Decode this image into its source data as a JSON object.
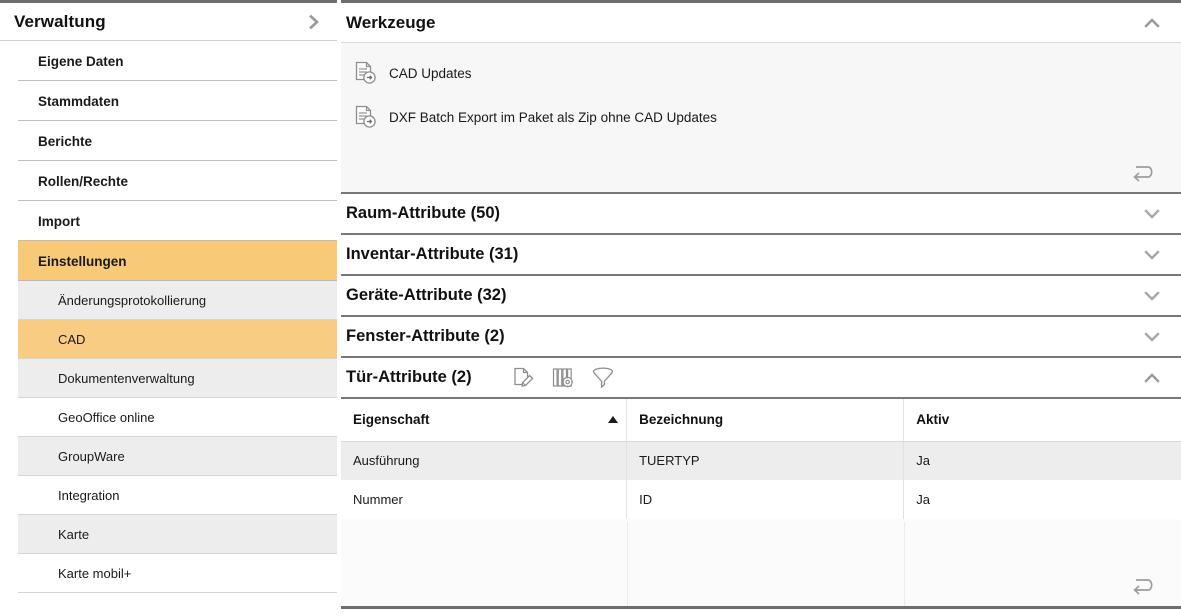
{
  "sidebar": {
    "title": "Verwaltung",
    "expand_icon": "chevron-right-icon",
    "items": [
      {
        "label": "Eigene Daten",
        "selected": false
      },
      {
        "label": "Stammdaten",
        "selected": false
      },
      {
        "label": "Berichte",
        "selected": false
      },
      {
        "label": "Rollen/Rechte",
        "selected": false
      },
      {
        "label": "Import",
        "selected": false
      },
      {
        "label": "Einstellungen",
        "selected": true
      }
    ],
    "subitems": [
      {
        "label": "Änderungsprotokollierung",
        "selected": false,
        "shaded": true
      },
      {
        "label": "CAD",
        "selected": true,
        "shaded": false
      },
      {
        "label": "Dokumentenverwaltung",
        "selected": false,
        "shaded": true
      },
      {
        "label": "GeoOffice online",
        "selected": false,
        "shaded": false
      },
      {
        "label": "GroupWare",
        "selected": false,
        "shaded": true
      },
      {
        "label": "Integration",
        "selected": false,
        "shaded": false
      },
      {
        "label": "Karte",
        "selected": false,
        "shaded": true
      },
      {
        "label": "Karte mobil+",
        "selected": false,
        "shaded": false
      }
    ],
    "highlight_color": "#f8c977",
    "subhighlight_color": "#f8cd83"
  },
  "tools_panel": {
    "title": "Werkzeuge",
    "collapse_icon": "chevron-up-icon",
    "expanded": true,
    "items": [
      {
        "label": "CAD Updates",
        "icon": "document-export-icon"
      },
      {
        "label": "DXF Batch Export im Paket als Zip ohne CAD Updates",
        "icon": "document-export-icon"
      }
    ],
    "undo_icon": "return-arrow-icon"
  },
  "sections": [
    {
      "title": "Raum-Attribute (50)",
      "count": 50,
      "expanded": false,
      "icon": "chevron-down-icon"
    },
    {
      "title": "Inventar-Attribute (31)",
      "count": 31,
      "expanded": false,
      "icon": "chevron-down-icon"
    },
    {
      "title": "Geräte-Attribute (32)",
      "count": 32,
      "expanded": false,
      "icon": "chevron-down-icon"
    },
    {
      "title": "Fenster-Attribute (2)",
      "count": 2,
      "expanded": false,
      "icon": "chevron-down-icon"
    }
  ],
  "open_section": {
    "title": "Tür-Attribute (2)",
    "count": 2,
    "expanded": true,
    "collapse_icon": "chevron-up-icon",
    "toolbar": [
      {
        "name": "edit-document-icon",
        "label": "Bearbeiten"
      },
      {
        "name": "column-settings-icon",
        "label": "Spalten"
      },
      {
        "name": "filter-funnel-icon",
        "label": "Filter"
      }
    ],
    "table": {
      "columns": [
        {
          "label": "Eigenschaft",
          "sort": "asc"
        },
        {
          "label": "Bezeichnung",
          "sort": "none"
        },
        {
          "label": "Aktiv",
          "sort": "none"
        }
      ],
      "rows": [
        {
          "eigenschaft": "Ausführung",
          "bezeichnung": "TUERTYP",
          "aktiv": "Ja"
        },
        {
          "eigenschaft": "Nummer",
          "bezeichnung": "ID",
          "aktiv": "Ja"
        }
      ]
    },
    "undo_icon": "return-arrow-icon"
  }
}
